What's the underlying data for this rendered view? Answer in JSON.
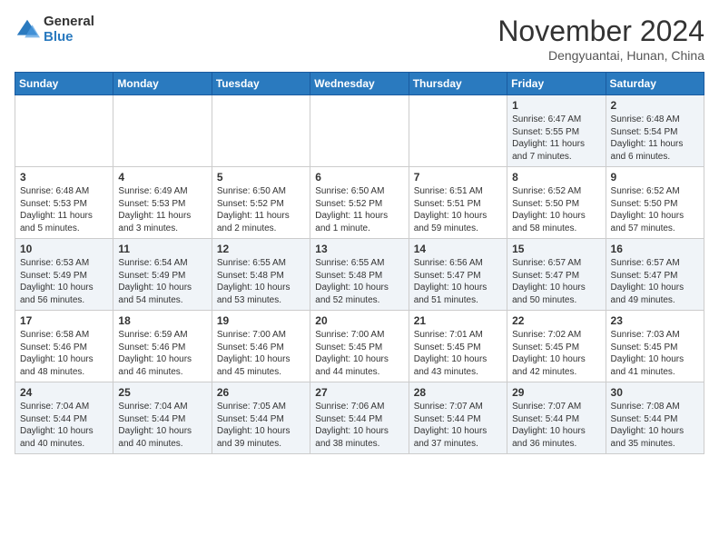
{
  "header": {
    "logo_general": "General",
    "logo_blue": "Blue",
    "month_title": "November 2024",
    "location": "Dengyuantai, Hunan, China"
  },
  "calendar": {
    "days_of_week": [
      "Sunday",
      "Monday",
      "Tuesday",
      "Wednesday",
      "Thursday",
      "Friday",
      "Saturday"
    ],
    "weeks": [
      [
        {
          "day": "",
          "info": ""
        },
        {
          "day": "",
          "info": ""
        },
        {
          "day": "",
          "info": ""
        },
        {
          "day": "",
          "info": ""
        },
        {
          "day": "",
          "info": ""
        },
        {
          "day": "1",
          "info": "Sunrise: 6:47 AM\nSunset: 5:55 PM\nDaylight: 11 hours\nand 7 minutes."
        },
        {
          "day": "2",
          "info": "Sunrise: 6:48 AM\nSunset: 5:54 PM\nDaylight: 11 hours\nand 6 minutes."
        }
      ],
      [
        {
          "day": "3",
          "info": "Sunrise: 6:48 AM\nSunset: 5:53 PM\nDaylight: 11 hours\nand 5 minutes."
        },
        {
          "day": "4",
          "info": "Sunrise: 6:49 AM\nSunset: 5:53 PM\nDaylight: 11 hours\nand 3 minutes."
        },
        {
          "day": "5",
          "info": "Sunrise: 6:50 AM\nSunset: 5:52 PM\nDaylight: 11 hours\nand 2 minutes."
        },
        {
          "day": "6",
          "info": "Sunrise: 6:50 AM\nSunset: 5:52 PM\nDaylight: 11 hours\nand 1 minute."
        },
        {
          "day": "7",
          "info": "Sunrise: 6:51 AM\nSunset: 5:51 PM\nDaylight: 10 hours\nand 59 minutes."
        },
        {
          "day": "8",
          "info": "Sunrise: 6:52 AM\nSunset: 5:50 PM\nDaylight: 10 hours\nand 58 minutes."
        },
        {
          "day": "9",
          "info": "Sunrise: 6:52 AM\nSunset: 5:50 PM\nDaylight: 10 hours\nand 57 minutes."
        }
      ],
      [
        {
          "day": "10",
          "info": "Sunrise: 6:53 AM\nSunset: 5:49 PM\nDaylight: 10 hours\nand 56 minutes."
        },
        {
          "day": "11",
          "info": "Sunrise: 6:54 AM\nSunset: 5:49 PM\nDaylight: 10 hours\nand 54 minutes."
        },
        {
          "day": "12",
          "info": "Sunrise: 6:55 AM\nSunset: 5:48 PM\nDaylight: 10 hours\nand 53 minutes."
        },
        {
          "day": "13",
          "info": "Sunrise: 6:55 AM\nSunset: 5:48 PM\nDaylight: 10 hours\nand 52 minutes."
        },
        {
          "day": "14",
          "info": "Sunrise: 6:56 AM\nSunset: 5:47 PM\nDaylight: 10 hours\nand 51 minutes."
        },
        {
          "day": "15",
          "info": "Sunrise: 6:57 AM\nSunset: 5:47 PM\nDaylight: 10 hours\nand 50 minutes."
        },
        {
          "day": "16",
          "info": "Sunrise: 6:57 AM\nSunset: 5:47 PM\nDaylight: 10 hours\nand 49 minutes."
        }
      ],
      [
        {
          "day": "17",
          "info": "Sunrise: 6:58 AM\nSunset: 5:46 PM\nDaylight: 10 hours\nand 48 minutes."
        },
        {
          "day": "18",
          "info": "Sunrise: 6:59 AM\nSunset: 5:46 PM\nDaylight: 10 hours\nand 46 minutes."
        },
        {
          "day": "19",
          "info": "Sunrise: 7:00 AM\nSunset: 5:46 PM\nDaylight: 10 hours\nand 45 minutes."
        },
        {
          "day": "20",
          "info": "Sunrise: 7:00 AM\nSunset: 5:45 PM\nDaylight: 10 hours\nand 44 minutes."
        },
        {
          "day": "21",
          "info": "Sunrise: 7:01 AM\nSunset: 5:45 PM\nDaylight: 10 hours\nand 43 minutes."
        },
        {
          "day": "22",
          "info": "Sunrise: 7:02 AM\nSunset: 5:45 PM\nDaylight: 10 hours\nand 42 minutes."
        },
        {
          "day": "23",
          "info": "Sunrise: 7:03 AM\nSunset: 5:45 PM\nDaylight: 10 hours\nand 41 minutes."
        }
      ],
      [
        {
          "day": "24",
          "info": "Sunrise: 7:04 AM\nSunset: 5:44 PM\nDaylight: 10 hours\nand 40 minutes."
        },
        {
          "day": "25",
          "info": "Sunrise: 7:04 AM\nSunset: 5:44 PM\nDaylight: 10 hours\nand 40 minutes."
        },
        {
          "day": "26",
          "info": "Sunrise: 7:05 AM\nSunset: 5:44 PM\nDaylight: 10 hours\nand 39 minutes."
        },
        {
          "day": "27",
          "info": "Sunrise: 7:06 AM\nSunset: 5:44 PM\nDaylight: 10 hours\nand 38 minutes."
        },
        {
          "day": "28",
          "info": "Sunrise: 7:07 AM\nSunset: 5:44 PM\nDaylight: 10 hours\nand 37 minutes."
        },
        {
          "day": "29",
          "info": "Sunrise: 7:07 AM\nSunset: 5:44 PM\nDaylight: 10 hours\nand 36 minutes."
        },
        {
          "day": "30",
          "info": "Sunrise: 7:08 AM\nSunset: 5:44 PM\nDaylight: 10 hours\nand 35 minutes."
        }
      ]
    ]
  }
}
